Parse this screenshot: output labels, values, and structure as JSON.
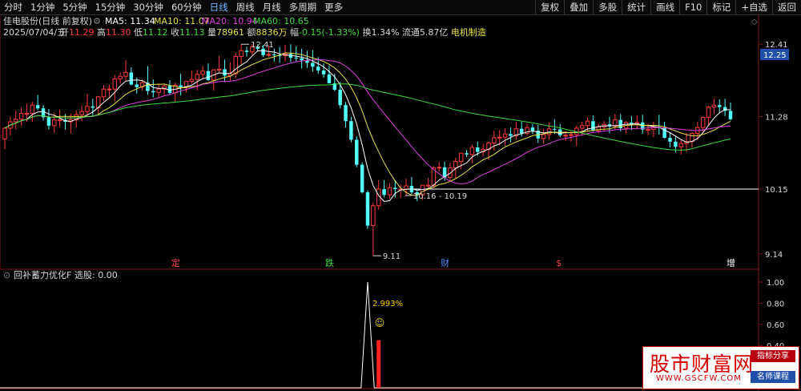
{
  "tabs": [
    {
      "label": "分时",
      "active": false
    },
    {
      "label": "1分钟",
      "active": false
    },
    {
      "label": "5分钟",
      "active": false
    },
    {
      "label": "15分钟",
      "active": false
    },
    {
      "label": "30分钟",
      "active": false
    },
    {
      "label": "60分钟",
      "active": false
    },
    {
      "label": "日线",
      "active": true
    },
    {
      "label": "周线",
      "active": false
    },
    {
      "label": "月线",
      "active": false
    },
    {
      "label": "多周期",
      "active": false
    },
    {
      "label": "更多",
      "active": false
    }
  ],
  "tools": [
    "复权",
    "叠加",
    "多股",
    "统计",
    "画线",
    "F10",
    "标记",
    "+自选",
    "返回"
  ],
  "header": {
    "title": "佳电股份(日线 前复权)",
    "ma5": "MA5: 11.34",
    "ma10": "MA10: 11.07",
    "ma20": "MA20: 10.94",
    "ma60": "MA60: 10.65",
    "date": "2025/07/04/五",
    "open_l": "开",
    "open": "11.29",
    "high_l": "高",
    "high": "11.30",
    "low_l": "低",
    "low": "11.12",
    "close_l": "收",
    "close": "11.13",
    "vol_l": "量",
    "vol": "78961",
    "amt_l": "额",
    "amt": "8836万",
    "chg_l": "幅",
    "chg": "-0.15(-1.33%)",
    "turnover": "换1.34%",
    "float": "流通5.87亿",
    "sector": "电机制造"
  },
  "indicator": {
    "title": "回补蓄力优化F",
    "signal": "选股: 0.00",
    "annotation": "2.993%"
  },
  "watermark": {
    "title": "股市财富网",
    "url": "WWW.GSCFW.COM",
    "badge1": "指标分享",
    "badge2": "名师课程"
  },
  "colors": {
    "up": "#ff3b3b",
    "down": "#54ffff",
    "ma5": "#ffffff",
    "ma10": "#e8e24a",
    "ma20": "#e040e0",
    "ma60": "#3fdc3f"
  },
  "chart_data": {
    "type": "candlestick",
    "price_axis": {
      "min": 9.0,
      "max": 12.5,
      "ticks": [
        "12.41",
        "11.28",
        "10.15",
        "9.14"
      ],
      "current": "12.25"
    },
    "annotations": {
      "high_label": "12.41",
      "low_label": "9.11",
      "range_label": "10.16 - 10.19",
      "support_level": 10.15
    },
    "event_markers": [
      {
        "label": "定",
        "index": 31,
        "color": "#ff4040"
      },
      {
        "label": "跌",
        "index": 59,
        "color": "#3fdc3f"
      },
      {
        "label": "财",
        "index": 80,
        "color": "#4f8bff"
      },
      {
        "label": "$",
        "index": 101,
        "color": "#ff4040"
      },
      {
        "label": "增",
        "index": 132,
        "color": "#ffffff"
      }
    ],
    "ohlc": [
      [
        10.93,
        11.12,
        10.77,
        11.1
      ],
      [
        11.1,
        11.28,
        10.99,
        11.2
      ],
      [
        11.2,
        11.37,
        11.08,
        11.24
      ],
      [
        11.24,
        11.42,
        11.14,
        11.33
      ],
      [
        11.33,
        11.48,
        11.2,
        11.33
      ],
      [
        11.33,
        11.51,
        11.2,
        11.46
      ],
      [
        11.46,
        11.62,
        11.38,
        11.41
      ],
      [
        11.41,
        11.46,
        11.22,
        11.27
      ],
      [
        11.27,
        11.4,
        11.08,
        11.14
      ],
      [
        11.14,
        11.34,
        11.03,
        11.23
      ],
      [
        11.23,
        11.39,
        11.12,
        11.23
      ],
      [
        11.23,
        11.32,
        11.08,
        11.2
      ],
      [
        11.2,
        11.33,
        11.02,
        11.23
      ],
      [
        11.23,
        11.38,
        11.11,
        11.31
      ],
      [
        11.31,
        11.46,
        11.21,
        11.36
      ],
      [
        11.36,
        11.64,
        11.29,
        11.44
      ],
      [
        11.44,
        11.56,
        11.29,
        11.42
      ],
      [
        11.42,
        11.6,
        11.32,
        11.59
      ],
      [
        11.59,
        11.77,
        11.53,
        11.71
      ],
      [
        11.71,
        11.78,
        11.59,
        11.71
      ],
      [
        11.71,
        11.93,
        11.52,
        11.87
      ],
      [
        11.87,
        11.97,
        11.79,
        11.91
      ],
      [
        11.91,
        12.16,
        11.84,
        11.97
      ],
      [
        11.97,
        12.05,
        11.77,
        11.78
      ],
      [
        11.78,
        11.89,
        11.64,
        11.74
      ],
      [
        11.74,
        11.86,
        11.69,
        11.81
      ],
      [
        11.81,
        12.07,
        11.62,
        11.68
      ],
      [
        11.68,
        11.86,
        11.58,
        11.66
      ],
      [
        11.66,
        11.8,
        11.58,
        11.71
      ],
      [
        11.71,
        11.79,
        11.61,
        11.76
      ],
      [
        11.76,
        11.85,
        11.63,
        11.65
      ],
      [
        11.65,
        11.81,
        11.51,
        11.77
      ],
      [
        11.77,
        11.95,
        11.61,
        11.74
      ],
      [
        11.74,
        11.84,
        11.66,
        11.83
      ],
      [
        11.83,
        12.0,
        11.79,
        11.86
      ],
      [
        11.86,
        12.01,
        11.69,
        11.94
      ],
      [
        11.94,
        12.07,
        11.88,
        11.99
      ],
      [
        11.99,
        12.11,
        11.84,
        11.85
      ],
      [
        11.85,
        12.02,
        11.69,
        12.01
      ],
      [
        12.01,
        12.23,
        11.96,
        12.02
      ],
      [
        12.02,
        12.17,
        11.82,
        11.92
      ],
      [
        11.92,
        12.13,
        11.84,
        11.95
      ],
      [
        11.95,
        12.27,
        11.88,
        12.22
      ],
      [
        12.22,
        12.41,
        12.1,
        12.31
      ],
      [
        12.31,
        12.37,
        12.22,
        12.29
      ],
      [
        12.29,
        12.41,
        12.24,
        12.37
      ],
      [
        12.37,
        12.41,
        12.3,
        12.34
      ],
      [
        12.34,
        12.4,
        12.21,
        12.24
      ],
      [
        12.24,
        12.39,
        12.21,
        12.25
      ],
      [
        12.25,
        12.34,
        12.14,
        12.24
      ],
      [
        12.24,
        12.37,
        12.12,
        12.23
      ],
      [
        12.23,
        12.4,
        12.14,
        12.26
      ],
      [
        12.26,
        12.41,
        12.13,
        12.2
      ],
      [
        12.2,
        12.38,
        12.14,
        12.19
      ],
      [
        12.19,
        12.34,
        12.03,
        12.16
      ],
      [
        12.16,
        12.31,
        12.04,
        12.12
      ],
      [
        12.12,
        12.32,
        11.98,
        12.06
      ],
      [
        12.06,
        12.21,
        11.95,
        12.0
      ],
      [
        12.0,
        12.11,
        11.89,
        11.94
      ],
      [
        11.94,
        12.08,
        11.8,
        11.8
      ],
      [
        11.8,
        11.95,
        11.68,
        11.7
      ],
      [
        11.7,
        11.82,
        11.41,
        11.46
      ],
      [
        11.46,
        11.51,
        11.11,
        11.21
      ],
      [
        11.21,
        11.28,
        10.88,
        10.92
      ],
      [
        10.92,
        10.97,
        10.49,
        10.53
      ],
      [
        10.53,
        10.57,
        10.08,
        10.1
      ],
      [
        10.1,
        10.13,
        9.53,
        9.58
      ],
      [
        9.58,
        9.94,
        9.11,
        9.89
      ],
      [
        9.89,
        10.29,
        9.83,
        10.15
      ],
      [
        10.15,
        10.29,
        10.02,
        10.06
      ],
      [
        10.06,
        10.24,
        10.0,
        10.17
      ],
      [
        10.17,
        10.29,
        10.02,
        10.15
      ],
      [
        10.15,
        10.22,
        10.01,
        10.15
      ],
      [
        10.15,
        10.31,
        10.04,
        10.2
      ],
      [
        10.2,
        10.34,
        10.07,
        10.1
      ],
      [
        10.1,
        10.15,
        9.96,
        10.06
      ],
      [
        10.06,
        10.21,
        9.98,
        10.21
      ],
      [
        10.21,
        10.32,
        10.14,
        10.21
      ],
      [
        10.21,
        10.51,
        10.17,
        10.48
      ],
      [
        10.48,
        10.57,
        10.42,
        10.49
      ],
      [
        10.49,
        10.58,
        10.28,
        10.33
      ],
      [
        10.33,
        10.56,
        10.28,
        10.48
      ],
      [
        10.48,
        10.64,
        10.32,
        10.58
      ],
      [
        10.58,
        10.71,
        10.46,
        10.71
      ],
      [
        10.71,
        10.76,
        10.65,
        10.69
      ],
      [
        10.69,
        10.84,
        10.55,
        10.8
      ],
      [
        10.8,
        10.89,
        10.67,
        10.73
      ],
      [
        10.73,
        10.86,
        10.66,
        10.77
      ],
      [
        10.77,
        10.89,
        10.61,
        10.87
      ],
      [
        10.87,
        11.06,
        10.75,
        10.95
      ],
      [
        10.95,
        11.07,
        10.83,
        10.96
      ],
      [
        10.96,
        11.1,
        10.83,
        11.01
      ],
      [
        11.01,
        11.11,
        10.88,
        10.98
      ],
      [
        10.98,
        11.2,
        10.92,
        11.09
      ],
      [
        11.09,
        11.2,
        10.97,
        11.02
      ],
      [
        11.02,
        11.17,
        10.98,
        11.11
      ],
      [
        11.11,
        11.16,
        11.01,
        11.06
      ],
      [
        11.06,
        11.15,
        10.87,
        10.94
      ],
      [
        10.94,
        11.09,
        10.86,
        11.0
      ],
      [
        11.0,
        11.18,
        10.92,
        11.09
      ],
      [
        11.09,
        11.24,
        11.01,
        11.08
      ],
      [
        11.08,
        11.17,
        10.96,
        10.99
      ],
      [
        10.99,
        11.05,
        10.9,
        10.99
      ],
      [
        10.99,
        11.05,
        10.89,
        11.0
      ],
      [
        11.0,
        11.14,
        10.82,
        11.1
      ],
      [
        11.1,
        11.2,
        10.99,
        11.14
      ],
      [
        11.14,
        11.27,
        11.05,
        11.21
      ],
      [
        11.21,
        11.3,
        11.05,
        11.06
      ],
      [
        11.06,
        11.17,
        11.02,
        11.12
      ],
      [
        11.12,
        11.21,
        11.06,
        11.16
      ],
      [
        11.16,
        11.28,
        11.02,
        11.13
      ],
      [
        11.13,
        11.32,
        11.07,
        11.23
      ],
      [
        11.23,
        11.32,
        11.05,
        11.1
      ],
      [
        11.1,
        11.21,
        11.02,
        11.19
      ],
      [
        11.19,
        11.29,
        11.07,
        11.16
      ],
      [
        11.16,
        11.3,
        11.08,
        11.19
      ],
      [
        11.19,
        11.31,
        11.01,
        11.08
      ],
      [
        11.08,
        11.17,
        10.99,
        11.08
      ],
      [
        11.08,
        11.2,
        10.96,
        11.12
      ],
      [
        11.12,
        11.31,
        11.0,
        11.11
      ],
      [
        11.11,
        11.2,
        10.94,
        10.95
      ],
      [
        10.95,
        11.03,
        10.8,
        10.89
      ],
      [
        10.89,
        10.97,
        10.72,
        10.81
      ],
      [
        10.81,
        10.92,
        10.69,
        10.86
      ],
      [
        10.86,
        11.03,
        10.73,
        10.89
      ],
      [
        10.89,
        11.04,
        10.8,
        11.02
      ],
      [
        11.02,
        11.2,
        10.92,
        11.11
      ],
      [
        11.11,
        11.28,
        11.03,
        11.27
      ],
      [
        11.27,
        11.45,
        11.15,
        11.43
      ],
      [
        11.43,
        11.56,
        11.32,
        11.46
      ],
      [
        11.46,
        11.55,
        11.35,
        11.43
      ],
      [
        11.43,
        11.56,
        11.29,
        11.37
      ],
      [
        11.37,
        11.5,
        11.22,
        11.24
      ]
    ],
    "indicator_series": {
      "name": "回补蓄力优化F",
      "ticks": [
        "1.00",
        "0.80",
        "0.60",
        "0.40"
      ],
      "spike_index": 66,
      "spike_value": 1.0,
      "bar_index": 68,
      "bar_value": 0.45
    }
  }
}
